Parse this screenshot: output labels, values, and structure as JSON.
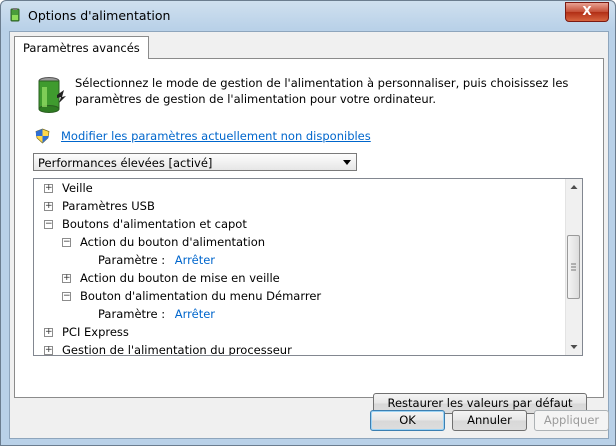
{
  "window": {
    "title": "Options d'alimentation",
    "close_label": "X"
  },
  "tab": {
    "label": "Paramètres avancés"
  },
  "description": "Sélectionnez le mode de gestion de l'alimentation à personnaliser, puis choisissez les paramètres de gestion de l'alimentation pour votre ordinateur.",
  "link": {
    "label": "Modifier les paramètres actuellement non disponibles"
  },
  "plan_select": {
    "value": "Performances élevées [activé]"
  },
  "tree": {
    "rows": [
      {
        "expander": "+",
        "label": "Veille"
      },
      {
        "expander": "+",
        "label": "Paramètres USB"
      },
      {
        "expander": "−",
        "label": "Boutons d'alimentation et capot"
      },
      {
        "expander": "−",
        "label": "Action du bouton d'alimentation"
      },
      {
        "label": "Paramètre :",
        "value": "Arrêter"
      },
      {
        "expander": "+",
        "label": "Action du bouton de mise en veille"
      },
      {
        "expander": "−",
        "label": "Bouton d'alimentation du menu Démarrer"
      },
      {
        "label": "Paramètre :",
        "value": "Arrêter"
      },
      {
        "expander": "+",
        "label": "PCI Express"
      },
      {
        "expander": "+",
        "label": "Gestion de l'alimentation du processeur"
      }
    ]
  },
  "buttons": {
    "restore": "Restaurer les valeurs par défaut",
    "ok": "OK",
    "cancel": "Annuler",
    "apply": "Appliquer"
  }
}
